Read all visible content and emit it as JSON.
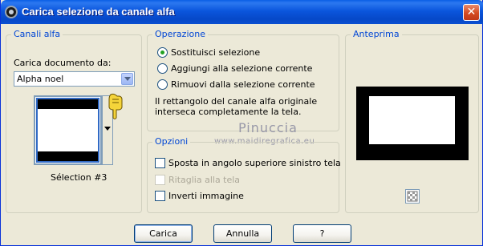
{
  "window": {
    "title": "Carica selezione da canale alfa",
    "close_glyph": "✕"
  },
  "canali": {
    "group_title": "Canali alfa",
    "doc_label": "Carica documento da:",
    "doc_value": "Alpha noel",
    "selection_caption": "Sélection #3"
  },
  "operazione": {
    "group_title": "Operazione",
    "options": [
      {
        "label": "Sostituisci selezione",
        "selected": true
      },
      {
        "label": "Aggiungi alla selezione corrente",
        "selected": false
      },
      {
        "label": "Rimuovi dalla selezione corrente",
        "selected": false
      }
    ],
    "info_line1": "Il rettangolo del canale alfa originale",
    "info_line2": "interseca completamente la tela."
  },
  "opzioni": {
    "group_title": "Opzioni",
    "checks": [
      {
        "label": "Sposta in angolo superiore sinistro tela",
        "checked": false,
        "enabled": true
      },
      {
        "label": "Ritaglia alla tela",
        "checked": false,
        "enabled": false
      },
      {
        "label": "Inverti immagine",
        "checked": false,
        "enabled": true
      }
    ]
  },
  "anteprima": {
    "group_title": "Anteprima"
  },
  "buttons": {
    "ok": "Carica",
    "cancel": "Annulla",
    "help": "?"
  },
  "watermark": {
    "name": "Pinuccia",
    "url": "www.maidiregrafica.eu"
  },
  "colors": {
    "titlebar": "#0054e3",
    "group_title": "#0046d5",
    "face": "#ece9d8"
  }
}
